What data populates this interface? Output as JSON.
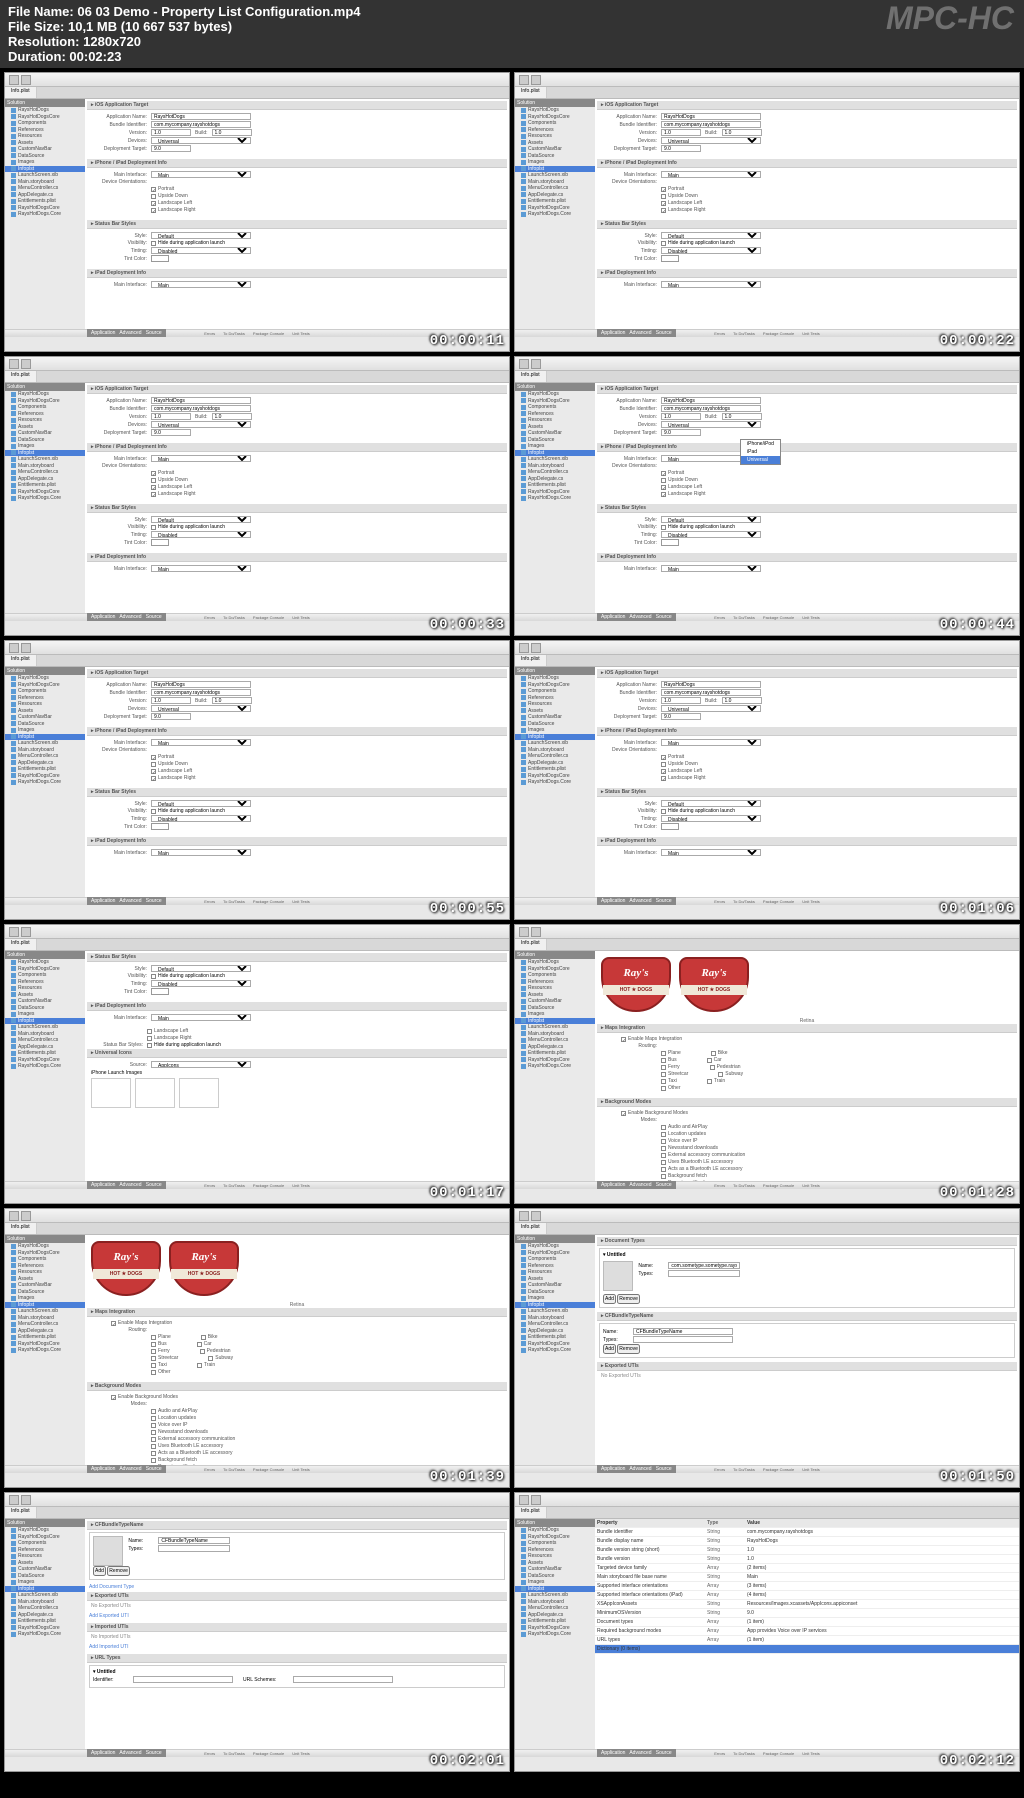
{
  "header": {
    "file_name_label": "File Name:",
    "file_name": "06 03 Demo - Property List Configuration.mp4",
    "file_size_label": "File Size:",
    "file_size": "10,1 MB (10 667 537 bytes)",
    "resolution_label": "Resolution:",
    "resolution": "1280x720",
    "duration_label": "Duration:",
    "duration": "00:02:23",
    "watermark": "MPC-HC"
  },
  "sidebar": {
    "header": "Solution",
    "items": [
      "RaysHotDogs",
      "RaysHotDogsCore",
      "Components",
      "References",
      "Resources",
      "Assets",
      "CustomNavBar",
      "DataSource",
      "Images",
      "Infoplst",
      "LaunchScreen.xib",
      "Main.storyboard",
      "MenuController.cs",
      "AppDelegate.cs",
      "Entitlements.plist",
      "RaysHotDogsCore",
      "RaysHotDogs.Core"
    ],
    "selected_index": 9
  },
  "sections": {
    "ios_target": "iOS Application Target",
    "deployment": "iPhone / iPad Deployment Info",
    "status_bar": "Status Bar Styles",
    "ipad_deployment": "iPad Deployment Info",
    "universal_icons": "Universal Icons",
    "maps": "Maps Integration",
    "background": "Background Modes",
    "document_types": "Document Types",
    "exported_uti": "Exported UTIs",
    "imported_uti": "Imported UTIs",
    "url_types": "URL Types",
    "bundle_name": "CFBundleTypeName"
  },
  "fields": {
    "app_name_label": "Application Name:",
    "app_name": "RaysHotDogs",
    "bundle_id_label": "Bundle Identifier:",
    "bundle_id": "com.mycompany.rayshotdogs",
    "version_label": "Version:",
    "version": "1.0",
    "build_label": "Build:",
    "build": "1.0",
    "devices_label": "Devices:",
    "devices": "Universal",
    "deployment_target_label": "Deployment Target:",
    "deployment_target": "9.0",
    "main_interface_label": "Main Interface:",
    "main_interface": "Main",
    "orientation_label": "Device Orientations:",
    "portrait": "Portrait",
    "upside_down": "Upside Down",
    "landscape_left": "Landscape Left",
    "landscape_right": "Landscape Right",
    "style_label": "Style:",
    "style": "Default",
    "visibility_label": "Visibility:",
    "visibility": "Hide during application launch",
    "tinting_label": "Tinting:",
    "tinting": "Disabled",
    "tint_color_label": "Tint Color:",
    "source_label": "Source:",
    "source": "AppIcons",
    "iphone_launch": "iPhone Launch Images",
    "enable_maps": "Enable Maps Integration",
    "routing_label": "Routing:",
    "plane": "Plane",
    "bike": "Bike",
    "bus": "Bus",
    "car": "Car",
    "ferry": "Ferry",
    "pedestrian": "Pedestrian",
    "streetcar": "Streetcar",
    "subway": "Subway",
    "taxi": "Taxi",
    "train": "Train",
    "other": "Other",
    "enable_bg": "Enable Background Modes",
    "modes_label": "Modes:",
    "audio": "Audio and AirPlay",
    "location": "Location updates",
    "voip": "Voice over IP",
    "newsstand": "Newsstand downloads",
    "ext_accessory": "External accessory communication",
    "bluetooth_le": "Uses Bluetooth LE accessory",
    "bluetooth_per": "Acts as a Bluetooth LE accessory",
    "fetch": "Background fetch",
    "remote": "Remote notifications",
    "add_btn": "Add",
    "remove_btn": "Remove",
    "name_label": "Name:",
    "types_label": "Types:",
    "identifier_label": "Identifier:",
    "url_schemes_label": "URL Schemes:",
    "no_exported": "No Exported UTIs",
    "add_exported": "Add Exported UTI",
    "no_imported": "No Imported UTIs",
    "add_imported": "Add Imported UTI",
    "unnamed": "Untitled",
    "add_doc_type": "Add Document Type"
  },
  "plist": {
    "header_property": "Property",
    "header_type": "Type",
    "header_value": "Value",
    "rows": [
      {
        "k": "Bundle identifier",
        "t": "String",
        "v": "com.mycompany.rayshotdogs"
      },
      {
        "k": "Bundle display name",
        "t": "String",
        "v": "RaysHotDogs"
      },
      {
        "k": "Bundle version string (short)",
        "t": "String",
        "v": "1.0"
      },
      {
        "k": "Bundle version",
        "t": "String",
        "v": "1.0"
      },
      {
        "k": "Targeted device family",
        "t": "Array",
        "v": "(2 items)"
      },
      {
        "k": "Main storyboard file base name",
        "t": "String",
        "v": "Main"
      },
      {
        "k": "Supported interface orientations",
        "t": "Array",
        "v": "(3 items)"
      },
      {
        "k": "Supported interface orientations (iPad)",
        "t": "Array",
        "v": "(4 items)"
      },
      {
        "k": "XSAppIconAssets",
        "t": "String",
        "v": "Resources/Images.xcassets/AppIcons.appiconset"
      },
      {
        "k": "MinimumOSVersion",
        "t": "String",
        "v": "9.0"
      },
      {
        "k": "Document types",
        "t": "Array",
        "v": "(1 item)"
      },
      {
        "k": "Required background modes",
        "t": "Array",
        "v": "App provides Voice over IP services"
      },
      {
        "k": "URL types",
        "t": "Array",
        "v": "(1 item)"
      },
      {
        "k": "Dictionary (0 items)",
        "t": "",
        "v": ""
      }
    ]
  },
  "tabs": {
    "application": "Application",
    "advanced": "Advanced",
    "source": "Source",
    "infoplist": "Info.plist"
  },
  "footer": {
    "errors": "Errors",
    "tasks": "To Do/Tasks",
    "package": "Package Console",
    "unit": "Unit Tests"
  },
  "logo": {
    "title": "Ray's",
    "band": "HOT ★ DOGS",
    "caption": "Retina"
  },
  "timestamps": [
    "00:00:11",
    "00:00:22",
    "00:00:33",
    "00:00:44",
    "00:00:55",
    "00:01:06",
    "00:01:17",
    "00:01:28",
    "00:01:39",
    "00:01:50",
    "00:02:01",
    "00:02:12"
  ],
  "dropdown": {
    "iphone_ipod": "iPhone/iPod",
    "ipad": "iPad",
    "universal": "Universal"
  }
}
